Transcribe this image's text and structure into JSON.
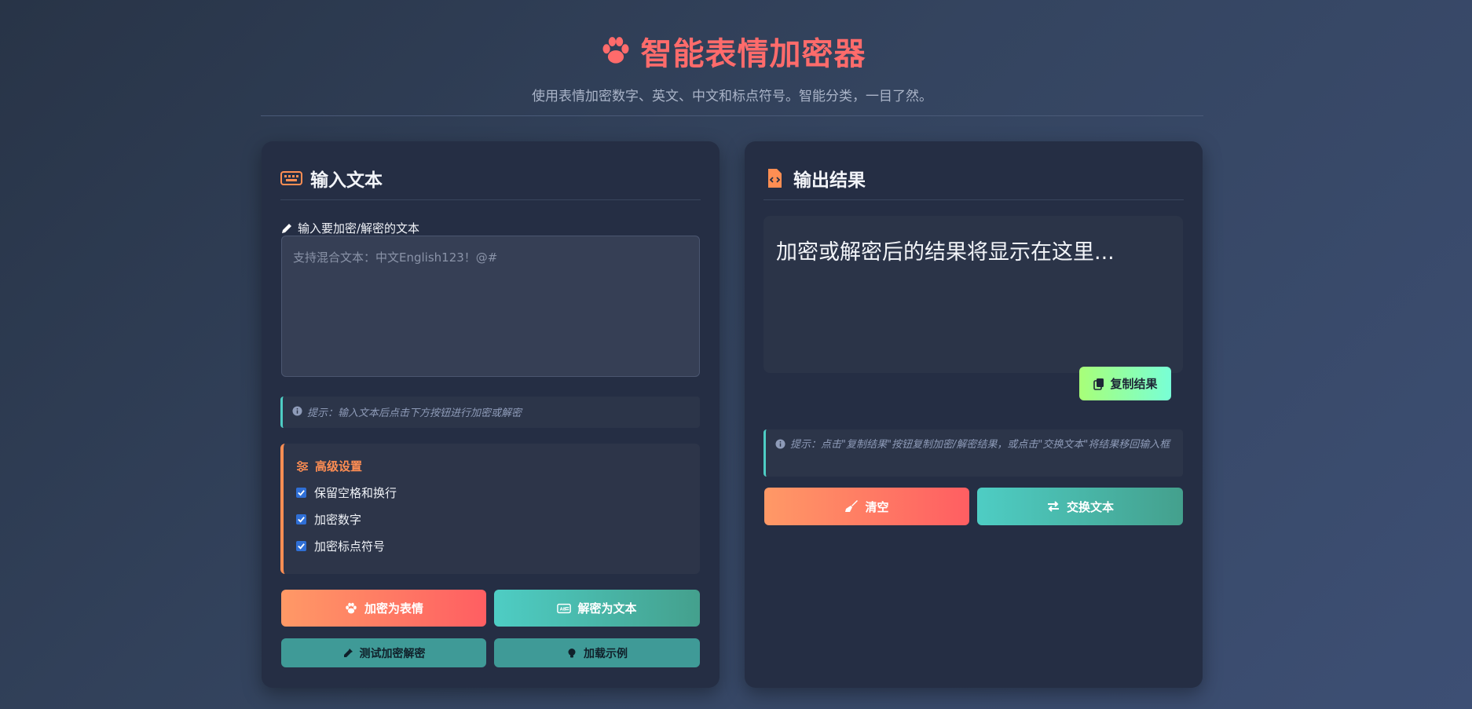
{
  "header": {
    "title": "智能表情加密器",
    "subtitle": "使用表情加密数字、英文、中文和标点符号。智能分类，一目了然。"
  },
  "input_panel": {
    "title": "输入文本",
    "field_label": "输入要加密/解密的文本",
    "placeholder": "支持混合文本：中文English123！@#",
    "tip": "提示：输入文本后点击下方按钮进行加密或解密",
    "settings": {
      "title": "高级设置",
      "options": [
        {
          "label": "保留空格和换行",
          "checked": true
        },
        {
          "label": "加密数字",
          "checked": true
        },
        {
          "label": "加密标点符号",
          "checked": true
        }
      ]
    },
    "buttons": {
      "encrypt": "加密为表情",
      "decrypt": "解密为文本",
      "test": "测试加密解密",
      "example": "加载示例"
    }
  },
  "output_panel": {
    "title": "输出结果",
    "result_placeholder": "加密或解密后的结果将显示在这里...",
    "copy": "复制结果",
    "tip": "提示：点击\"复制结果\"按钮复制加密/解密结果，或点击\"交换文本\"将结果移回输入框",
    "buttons": {
      "clear": "清空",
      "swap": "交换文本"
    }
  },
  "colors": {
    "accent_red": "#ff6b6b",
    "accent_orange": "#ff8e53",
    "accent_teal": "#4ecdc4",
    "panel": "#252e44"
  }
}
